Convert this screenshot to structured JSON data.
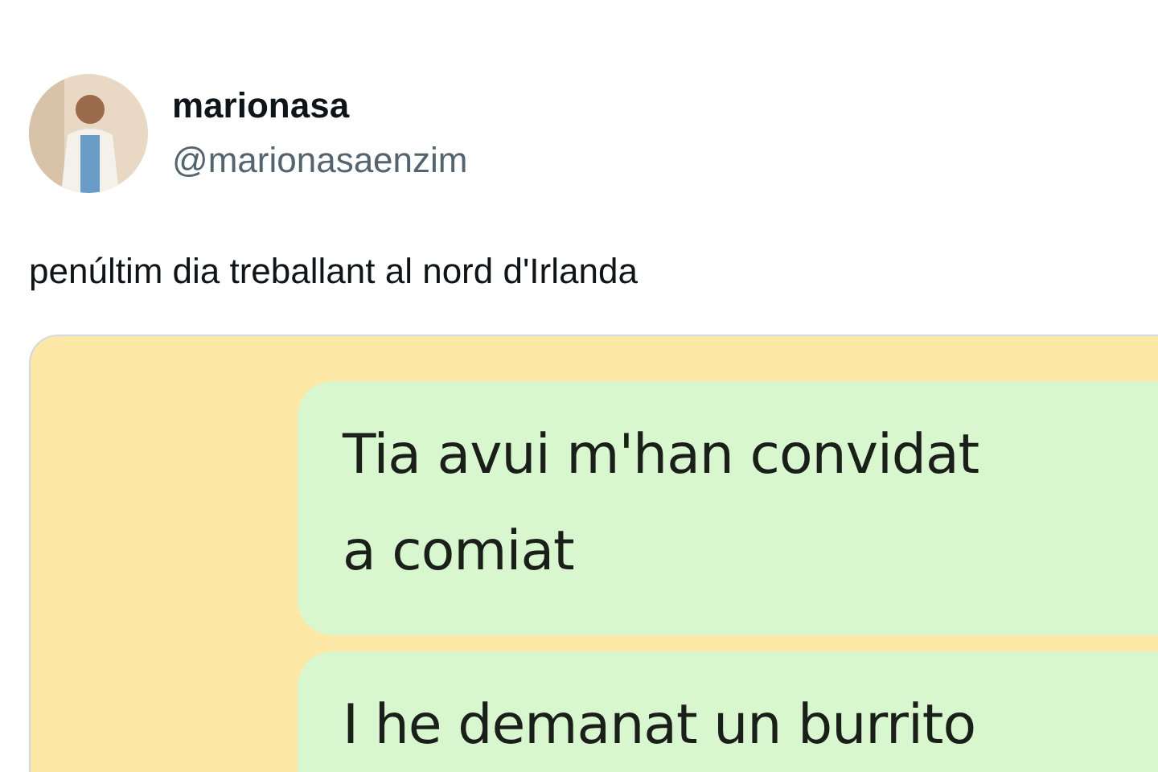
{
  "tweet": {
    "author": {
      "name": "marionasa",
      "handle": "@marionasaenzim"
    },
    "text": "penúltim dia treballant al nord d'Irlanda",
    "image": {
      "messages": [
        {
          "lines": [
            "Tia avui m'han convidat",
            "a comiat"
          ]
        },
        {
          "lines": [
            "I he demanat un burrito"
          ]
        }
      ]
    }
  }
}
